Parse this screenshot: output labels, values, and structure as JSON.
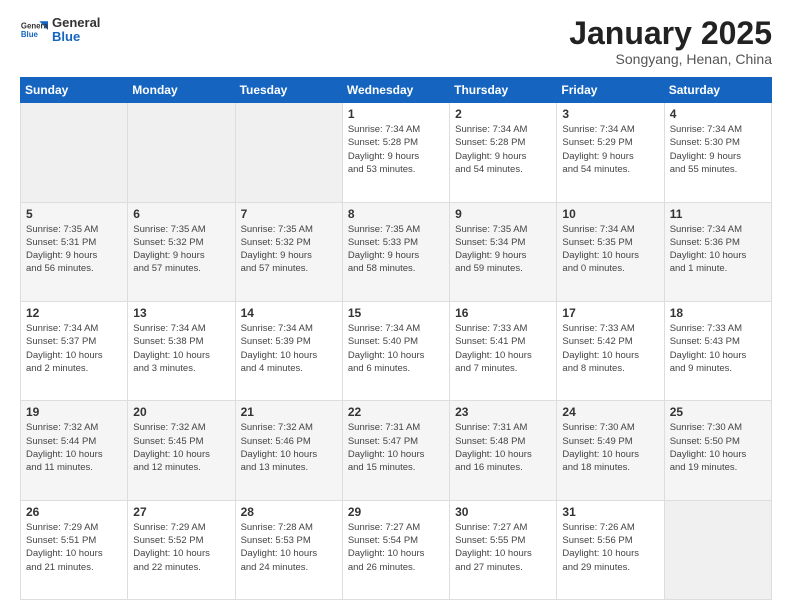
{
  "header": {
    "logo_general": "General",
    "logo_blue": "Blue",
    "month_title": "January 2025",
    "subtitle": "Songyang, Henan, China"
  },
  "days_of_week": [
    "Sunday",
    "Monday",
    "Tuesday",
    "Wednesday",
    "Thursday",
    "Friday",
    "Saturday"
  ],
  "weeks": [
    [
      {
        "day": "",
        "info": ""
      },
      {
        "day": "",
        "info": ""
      },
      {
        "day": "",
        "info": ""
      },
      {
        "day": "1",
        "info": "Sunrise: 7:34 AM\nSunset: 5:28 PM\nDaylight: 9 hours\nand 53 minutes."
      },
      {
        "day": "2",
        "info": "Sunrise: 7:34 AM\nSunset: 5:28 PM\nDaylight: 9 hours\nand 54 minutes."
      },
      {
        "day": "3",
        "info": "Sunrise: 7:34 AM\nSunset: 5:29 PM\nDaylight: 9 hours\nand 54 minutes."
      },
      {
        "day": "4",
        "info": "Sunrise: 7:34 AM\nSunset: 5:30 PM\nDaylight: 9 hours\nand 55 minutes."
      }
    ],
    [
      {
        "day": "5",
        "info": "Sunrise: 7:35 AM\nSunset: 5:31 PM\nDaylight: 9 hours\nand 56 minutes."
      },
      {
        "day": "6",
        "info": "Sunrise: 7:35 AM\nSunset: 5:32 PM\nDaylight: 9 hours\nand 57 minutes."
      },
      {
        "day": "7",
        "info": "Sunrise: 7:35 AM\nSunset: 5:32 PM\nDaylight: 9 hours\nand 57 minutes."
      },
      {
        "day": "8",
        "info": "Sunrise: 7:35 AM\nSunset: 5:33 PM\nDaylight: 9 hours\nand 58 minutes."
      },
      {
        "day": "9",
        "info": "Sunrise: 7:35 AM\nSunset: 5:34 PM\nDaylight: 9 hours\nand 59 minutes."
      },
      {
        "day": "10",
        "info": "Sunrise: 7:34 AM\nSunset: 5:35 PM\nDaylight: 10 hours\nand 0 minutes."
      },
      {
        "day": "11",
        "info": "Sunrise: 7:34 AM\nSunset: 5:36 PM\nDaylight: 10 hours\nand 1 minute."
      }
    ],
    [
      {
        "day": "12",
        "info": "Sunrise: 7:34 AM\nSunset: 5:37 PM\nDaylight: 10 hours\nand 2 minutes."
      },
      {
        "day": "13",
        "info": "Sunrise: 7:34 AM\nSunset: 5:38 PM\nDaylight: 10 hours\nand 3 minutes."
      },
      {
        "day": "14",
        "info": "Sunrise: 7:34 AM\nSunset: 5:39 PM\nDaylight: 10 hours\nand 4 minutes."
      },
      {
        "day": "15",
        "info": "Sunrise: 7:34 AM\nSunset: 5:40 PM\nDaylight: 10 hours\nand 6 minutes."
      },
      {
        "day": "16",
        "info": "Sunrise: 7:33 AM\nSunset: 5:41 PM\nDaylight: 10 hours\nand 7 minutes."
      },
      {
        "day": "17",
        "info": "Sunrise: 7:33 AM\nSunset: 5:42 PM\nDaylight: 10 hours\nand 8 minutes."
      },
      {
        "day": "18",
        "info": "Sunrise: 7:33 AM\nSunset: 5:43 PM\nDaylight: 10 hours\nand 9 minutes."
      }
    ],
    [
      {
        "day": "19",
        "info": "Sunrise: 7:32 AM\nSunset: 5:44 PM\nDaylight: 10 hours\nand 11 minutes."
      },
      {
        "day": "20",
        "info": "Sunrise: 7:32 AM\nSunset: 5:45 PM\nDaylight: 10 hours\nand 12 minutes."
      },
      {
        "day": "21",
        "info": "Sunrise: 7:32 AM\nSunset: 5:46 PM\nDaylight: 10 hours\nand 13 minutes."
      },
      {
        "day": "22",
        "info": "Sunrise: 7:31 AM\nSunset: 5:47 PM\nDaylight: 10 hours\nand 15 minutes."
      },
      {
        "day": "23",
        "info": "Sunrise: 7:31 AM\nSunset: 5:48 PM\nDaylight: 10 hours\nand 16 minutes."
      },
      {
        "day": "24",
        "info": "Sunrise: 7:30 AM\nSunset: 5:49 PM\nDaylight: 10 hours\nand 18 minutes."
      },
      {
        "day": "25",
        "info": "Sunrise: 7:30 AM\nSunset: 5:50 PM\nDaylight: 10 hours\nand 19 minutes."
      }
    ],
    [
      {
        "day": "26",
        "info": "Sunrise: 7:29 AM\nSunset: 5:51 PM\nDaylight: 10 hours\nand 21 minutes."
      },
      {
        "day": "27",
        "info": "Sunrise: 7:29 AM\nSunset: 5:52 PM\nDaylight: 10 hours\nand 22 minutes."
      },
      {
        "day": "28",
        "info": "Sunrise: 7:28 AM\nSunset: 5:53 PM\nDaylight: 10 hours\nand 24 minutes."
      },
      {
        "day": "29",
        "info": "Sunrise: 7:27 AM\nSunset: 5:54 PM\nDaylight: 10 hours\nand 26 minutes."
      },
      {
        "day": "30",
        "info": "Sunrise: 7:27 AM\nSunset: 5:55 PM\nDaylight: 10 hours\nand 27 minutes."
      },
      {
        "day": "31",
        "info": "Sunrise: 7:26 AM\nSunset: 5:56 PM\nDaylight: 10 hours\nand 29 minutes."
      },
      {
        "day": "",
        "info": ""
      }
    ]
  ]
}
